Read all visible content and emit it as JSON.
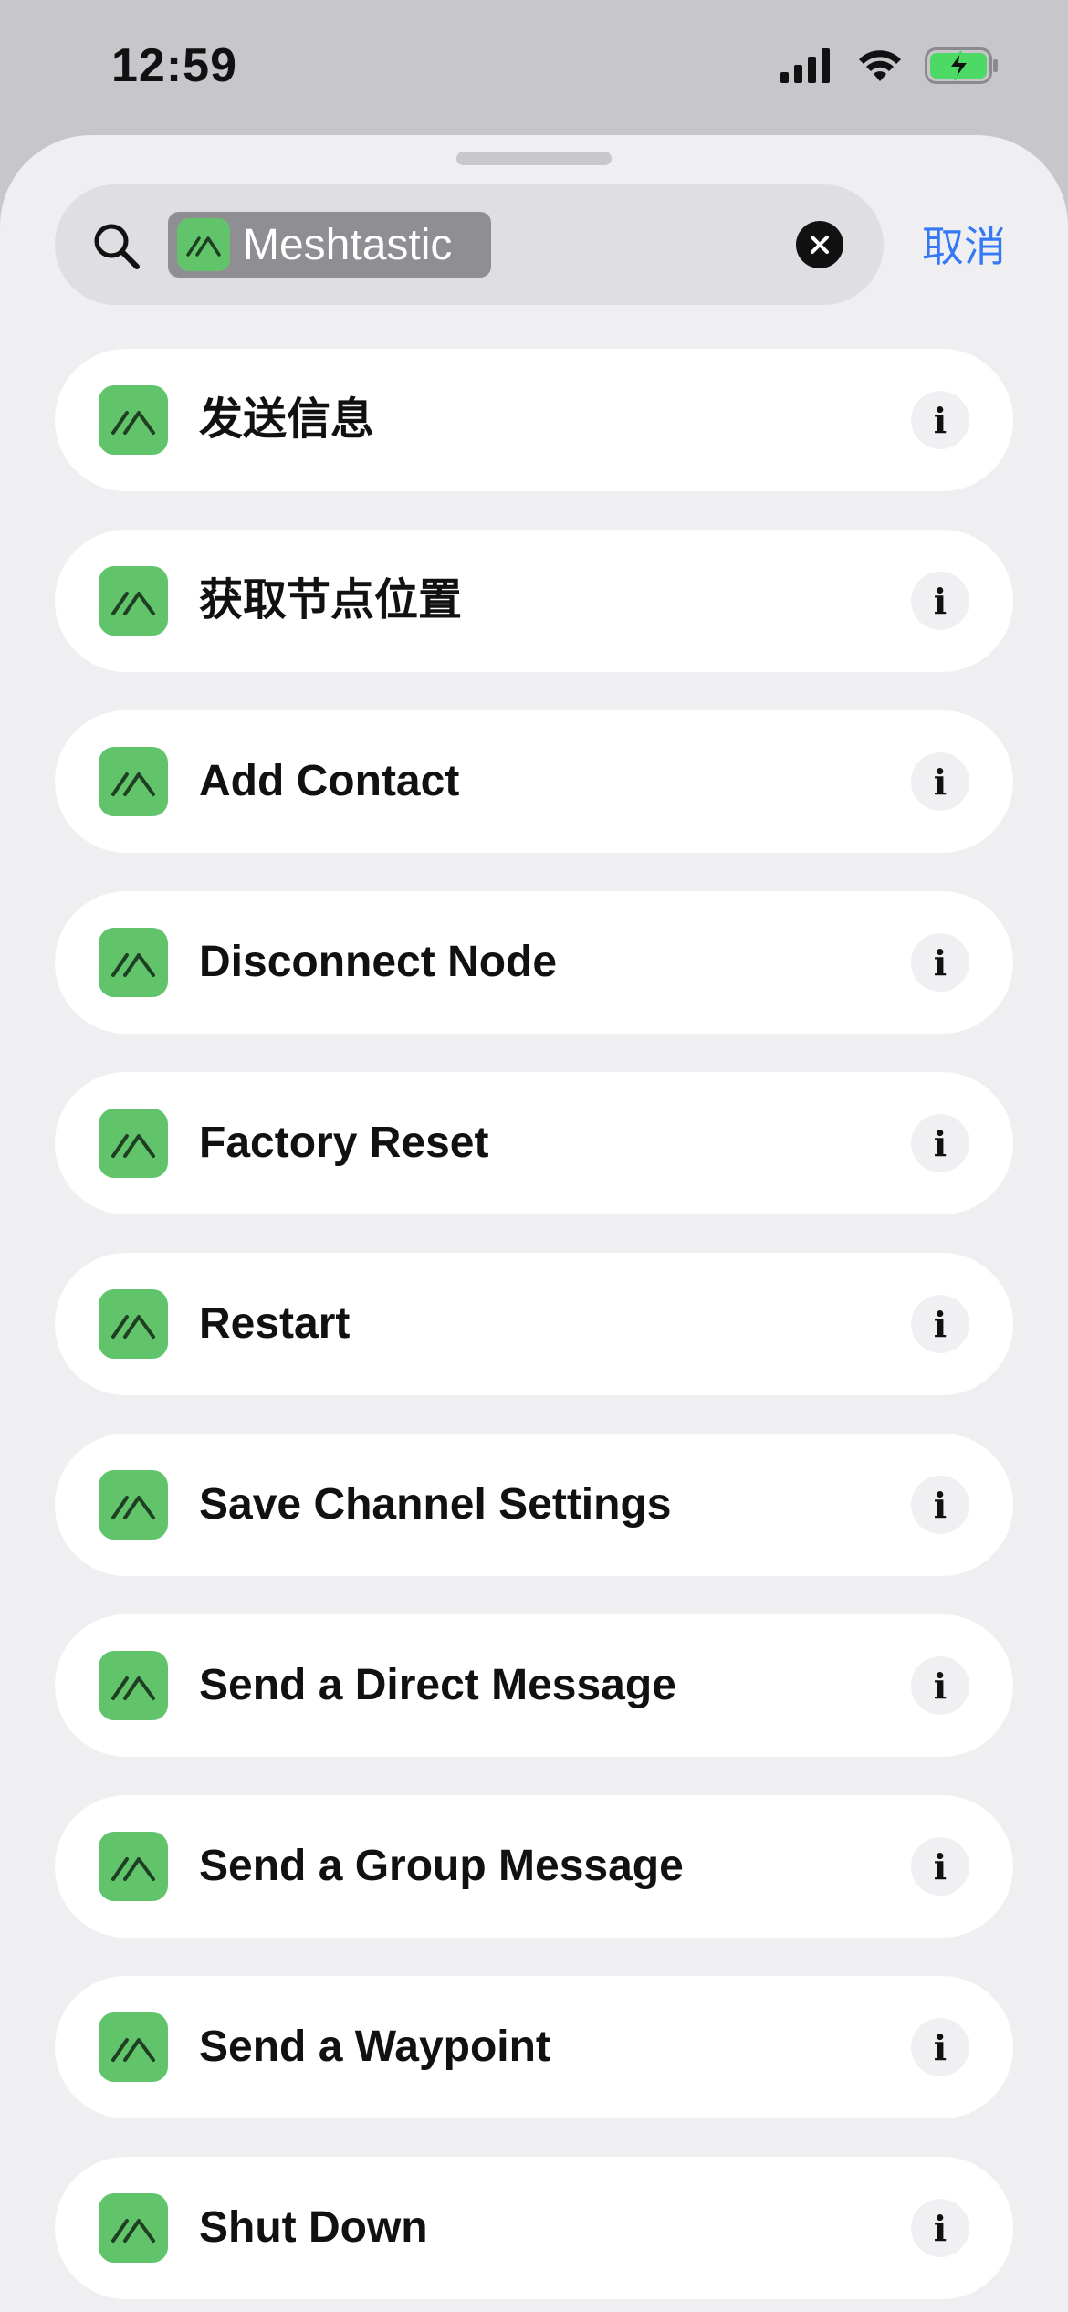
{
  "status_bar": {
    "time": "12:59",
    "icons": [
      "cellular-signal-icon",
      "wifi-icon",
      "battery-charging-icon"
    ],
    "battery_color": "#4cd964"
  },
  "search": {
    "icon": "magnifying-glass-icon",
    "token_label": "Meshtastic",
    "cancel_label": "取消"
  },
  "colors": {
    "accent": "#3478f6",
    "app_icon_green": "#62c46a"
  },
  "actions": [
    {
      "label": "发送信息"
    },
    {
      "label": "获取节点位置"
    },
    {
      "label": "Add Contact"
    },
    {
      "label": "Disconnect Node"
    },
    {
      "label": "Factory Reset"
    },
    {
      "label": "Restart"
    },
    {
      "label": "Save Channel Settings"
    },
    {
      "label": "Send a Direct Message"
    },
    {
      "label": "Send a Group Message"
    },
    {
      "label": "Send a Waypoint"
    },
    {
      "label": "Shut Down"
    }
  ],
  "info_glyph": "i"
}
